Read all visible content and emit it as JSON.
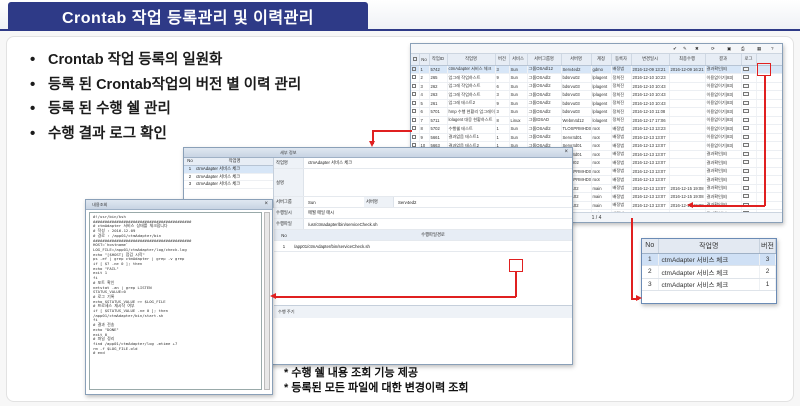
{
  "header": {
    "title": "Crontab 작업 등록관리 및 이력관리"
  },
  "bullets": [
    "Crontab 작업 등록의 일원화",
    "등록 된 Crontab작업의 버전 별 이력 관리",
    "등록 된 수행 쉘 관리",
    "수행 결과 로그 확인"
  ],
  "notes": [
    "* 수행 쉘 내용 조회 기능 제공",
    "* 등록된 모든 파일에 대한 변경이력 조회"
  ],
  "grid_window": {
    "columns": [
      "No",
      "작업ID",
      "작업명",
      "버전",
      "서비스",
      "서버그룹명",
      "서버명",
      "계정",
      "등록자",
      "변경일시",
      "최종수행",
      "결과",
      "로그"
    ],
    "rows": [
      [
        "1",
        "5742",
        "ctmAdapter 서비스 체크",
        "3",
        "Sun",
        "그룹OSAdl12",
        "Serv4ed2",
        "gdmo",
        "배정범",
        "2016-12-09 13:21",
        "2016-12-09 16:21",
        "결과확인(8)",
        ""
      ],
      [
        "2",
        "265",
        "업그레 작업하스트",
        "9",
        "Sun",
        "그룹OSAdl2",
        "bdsrvu02",
        "lplagent",
        "정희진",
        "2016-12-10 10:23",
        "",
        "이용없이기(83)",
        ""
      ],
      [
        "3",
        "262",
        "업그레 작업하스트",
        "6",
        "Sun",
        "그룹OSAdl2",
        "bdsrvu03",
        "lplagent",
        "정희진",
        "2016-12-10 10:43",
        "",
        "이용없이기(83)",
        ""
      ],
      [
        "4",
        "263",
        "업그레 작업하스트",
        "3",
        "Sun",
        "그룹OSAdl2",
        "bdsrvu03",
        "lplagent",
        "정희진",
        "2016-12-10 10:43",
        "",
        "이용없이기(83)",
        ""
      ],
      [
        "5",
        "261",
        "업그레 테스트2",
        "9",
        "Sun",
        "그룹OSAdl2",
        "bdsrvu03",
        "lplagent",
        "정희진",
        "2016-12-10 10:43",
        "",
        "이용없이기(83)",
        ""
      ],
      [
        "6",
        "5701",
        "hmp 수행 현황리 업그레이드",
        "3",
        "Sun",
        "그룹OSAdl2",
        "bdsrvu03",
        "lplagent",
        "정희진",
        "2016-12-10 11:08",
        "",
        "이용없이기(83)",
        ""
      ],
      [
        "7",
        "5711",
        "lolagent 대응 현황하스트",
        "8",
        "Linux",
        "그룹IDSAD",
        "Webm4d12",
        "lolagent",
        "정희진",
        "2016-12-17 17:06",
        "",
        "이용없이기(83)",
        ""
      ],
      [
        "8",
        "5702",
        "수행쉘 테스트",
        "1",
        "Sun",
        "그룹OSAdl2",
        "TLOSPRMHDS",
        "root",
        "배정범",
        "2016-12-13 13:23",
        "",
        "이용없이기(83)",
        ""
      ],
      [
        "9",
        "5661",
        "결과없음 테스트1",
        "1",
        "Sun",
        "그룹OSAdl2",
        "Servr4d01",
        "root",
        "배정범",
        "2016-12-13 13:07",
        "",
        "이용없이기(83)",
        ""
      ],
      [
        "10",
        "5663",
        "결과없음 테스트2",
        "1",
        "Sun",
        "그룹OSAdl2",
        "Servr4d01",
        "root",
        "배정범",
        "2016-12-13 13:07",
        "",
        "이용없이기(83)",
        ""
      ],
      [
        "11",
        "",
        "",
        "",
        "",
        "",
        "Servr4d01",
        "root",
        "배정범",
        "2016-12-13 13:07",
        "",
        "결과확인(8)",
        ""
      ],
      [
        "12",
        "",
        "",
        "",
        "",
        "",
        "ctrlpdr02",
        "root",
        "배정범",
        "2016-12-13 13:07",
        "",
        "결과확인(8)",
        ""
      ],
      [
        "13",
        "",
        "",
        "",
        "",
        "",
        "TLOSPRMHDS",
        "root",
        "배정범",
        "2016-12-13 13:07",
        "",
        "결과확인(8)",
        ""
      ],
      [
        "14",
        "",
        "",
        "",
        "",
        "",
        "TLOSPRMHDS",
        "root",
        "배정범",
        "2016-12-13 13:07",
        "",
        "결과확인(8)",
        ""
      ],
      [
        "15",
        "",
        "",
        "",
        "",
        "",
        "akah102",
        "main",
        "배정범",
        "2016-12-13 13:07",
        "2016-12-15 19:08",
        "결과확인(8)",
        ""
      ],
      [
        "16",
        "",
        "",
        "",
        "",
        "",
        "akah102",
        "main",
        "배정범",
        "2016-12-13 13:07",
        "2016-12-15 19:08",
        "결과확인(8)",
        ""
      ],
      [
        "17",
        "",
        "",
        "",
        "",
        "",
        "akah102",
        "main",
        "배정범",
        "2016-12-13 13:07",
        "2016-12-15 19:08",
        "결과확인(8)",
        ""
      ],
      [
        "18",
        "",
        "",
        "",
        "",
        "",
        "akah102",
        "main",
        "배정범",
        "2016-12-13 13:07",
        "2016-12-15 19:08",
        "결과확인(8)",
        ""
      ]
    ],
    "footer": "1 / 4"
  },
  "detail_window": {
    "title": "세부 정보",
    "list_header": [
      "No",
      "작업명"
    ],
    "list_rows": [
      [
        "1",
        "ctmAdapter 서비스 체크"
      ],
      [
        "2",
        "ctmAdapter 서비스 체크"
      ],
      [
        "3",
        "ctmAdapter 서비스 체크"
      ]
    ],
    "fields": [
      {
        "label": "작업명",
        "value": "ctmAdapter 서비스 체크"
      },
      {
        "label": "설명",
        "value": ""
      },
      {
        "label": "서버그룹",
        "value": "Sun"
      },
      {
        "label": "서버명",
        "value": "Serv4ed2"
      },
      {
        "label": "수행일시",
        "value": "매월 매일 매시"
      },
      {
        "label": "수행파일",
        "value": "/usr/ctmadapter/bin/serviceCheck.sh"
      }
    ],
    "table_header": [
      "No",
      "수행파일경로"
    ],
    "table_row": [
      "1",
      "/app01/ctmAdapter/bin/serviceCheck.sh"
    ],
    "schedule_section": "수행 주기"
  },
  "text_window": {
    "title": "내용조회",
    "lines": [
      "#!/usr/bin/ksh",
      "",
      "##########################################",
      "# ctmAdapter 서비스 상태를 체크합니다",
      "# 작성 : 2016.12.09",
      "# 경로 : /app01/ctmAdapter/bin",
      "##########################################",
      "",
      "HOST=`hostname`",
      "LOG_FILE=/app01/ctmAdapter/log/check.log",
      "",
      "echo \"[$HOST] 점검 시작\"",
      "ps -ef | grep ctmAdapter | grep -v grep",
      "if [ $? -ne 0 ]; then",
      "  echo \"FAIL\"",
      "  exit 1",
      "fi",
      "",
      "# 포트 확인",
      "netstat -an | grep LISTEN",
      "STATUS_VALUE=0",
      "",
      "# 로그 기록",
      "echo $STATUS_VALUE >> $LOG_FILE",
      "",
      "# 프로세스 재시작 여부",
      "if [ $STATUS_VALUE -ne 0 ]; then",
      "  /app01/ctmAdapter/bin/start.sh",
      "fi",
      "",
      "# 결과 전송",
      "echo \"DONE\"",
      "exit 0",
      "",
      "# 파일 정리",
      "find /app01/ctmAdapter/log -mtime +7",
      "rm -f $LOG_FILE.old",
      "",
      "# end"
    ]
  },
  "history_window": {
    "columns": [
      "No",
      "작업명",
      "버전"
    ],
    "rows": [
      [
        "1",
        "ctmAdapter 서비스 체크",
        "3"
      ],
      [
        "2",
        "ctmAdapter 서비스 체크",
        "2"
      ],
      [
        "3",
        "ctmAdapter 서비스 체크",
        "1"
      ]
    ]
  },
  "colors": {
    "title_bg": "#2e3a87",
    "callout": "#e02020",
    "selected_row": "#d7e6f7"
  }
}
